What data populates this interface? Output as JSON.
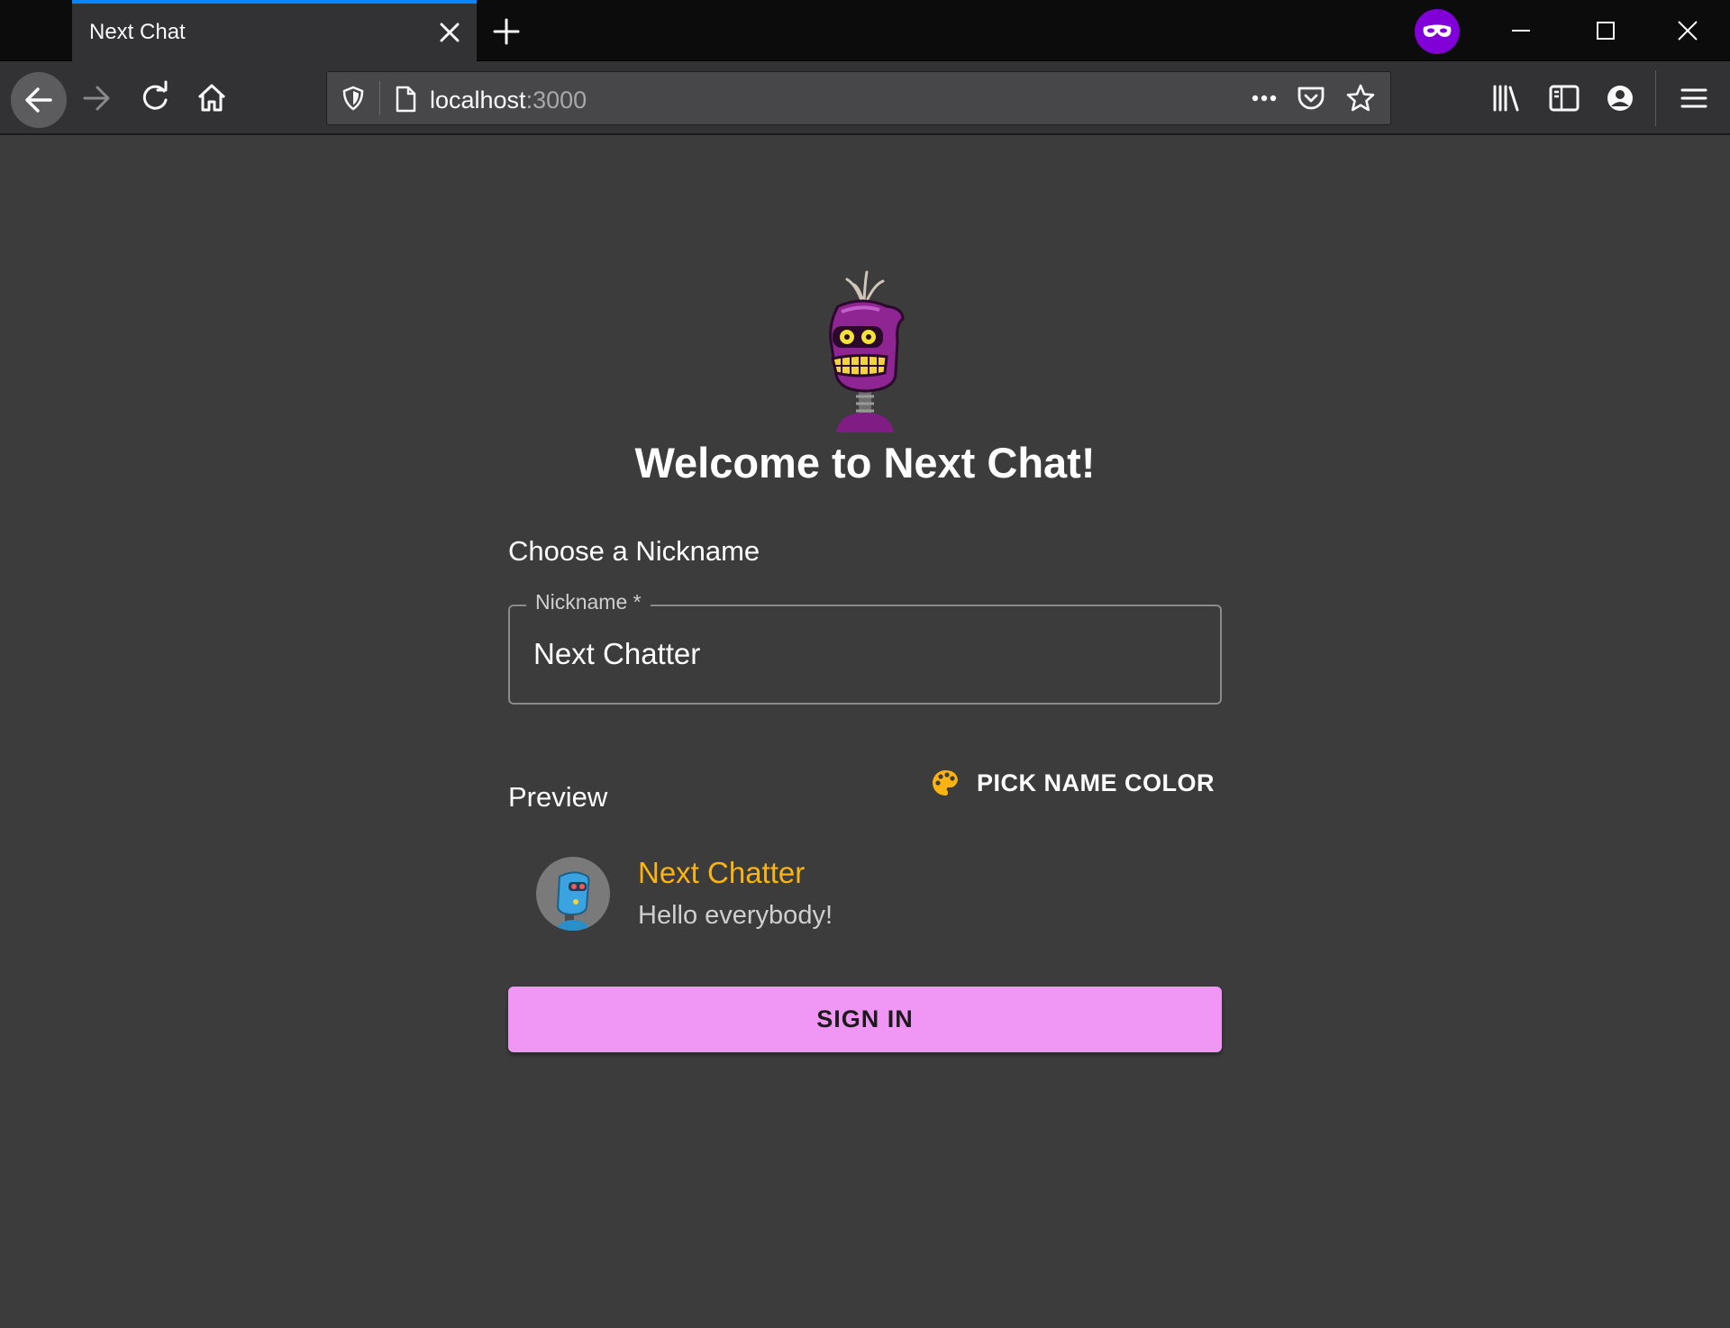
{
  "browser": {
    "tab_title": "Next Chat",
    "url_host": "localhost",
    "url_port": ":3000",
    "icons": {
      "tab_close": "close-icon",
      "new_tab": "plus-icon",
      "private": "private-browsing-mask-icon",
      "back": "arrow-left-icon",
      "forward": "arrow-right-icon",
      "reload": "reload-icon",
      "home": "home-icon",
      "shield": "tracking-shield-icon",
      "page": "page-icon",
      "more": "more-horizontal-icon",
      "pocket": "pocket-icon",
      "bookmark": "star-icon",
      "library": "library-icon",
      "sidebar": "sidebar-icon",
      "account": "account-icon",
      "menu": "hamburger-menu-icon"
    },
    "colors": {
      "private_badge": "#8000d7",
      "active_tab_accent": "#0a84ff"
    }
  },
  "page": {
    "title": "Welcome to Next Chat!",
    "nickname_section": "Choose a Nickname",
    "nickname_field": {
      "label": "Nickname *",
      "value": "Next Chatter"
    },
    "preview_section": "Preview",
    "pick_color_button": "PICK NAME COLOR",
    "preview": {
      "name": "Next Chatter",
      "message": "Hello everybody!"
    },
    "sign_in_button": "SIGN IN",
    "colors": {
      "name_color": "#fbb311",
      "sign_in_button": "#f097f5",
      "palette_icon": "#fbb311"
    }
  }
}
